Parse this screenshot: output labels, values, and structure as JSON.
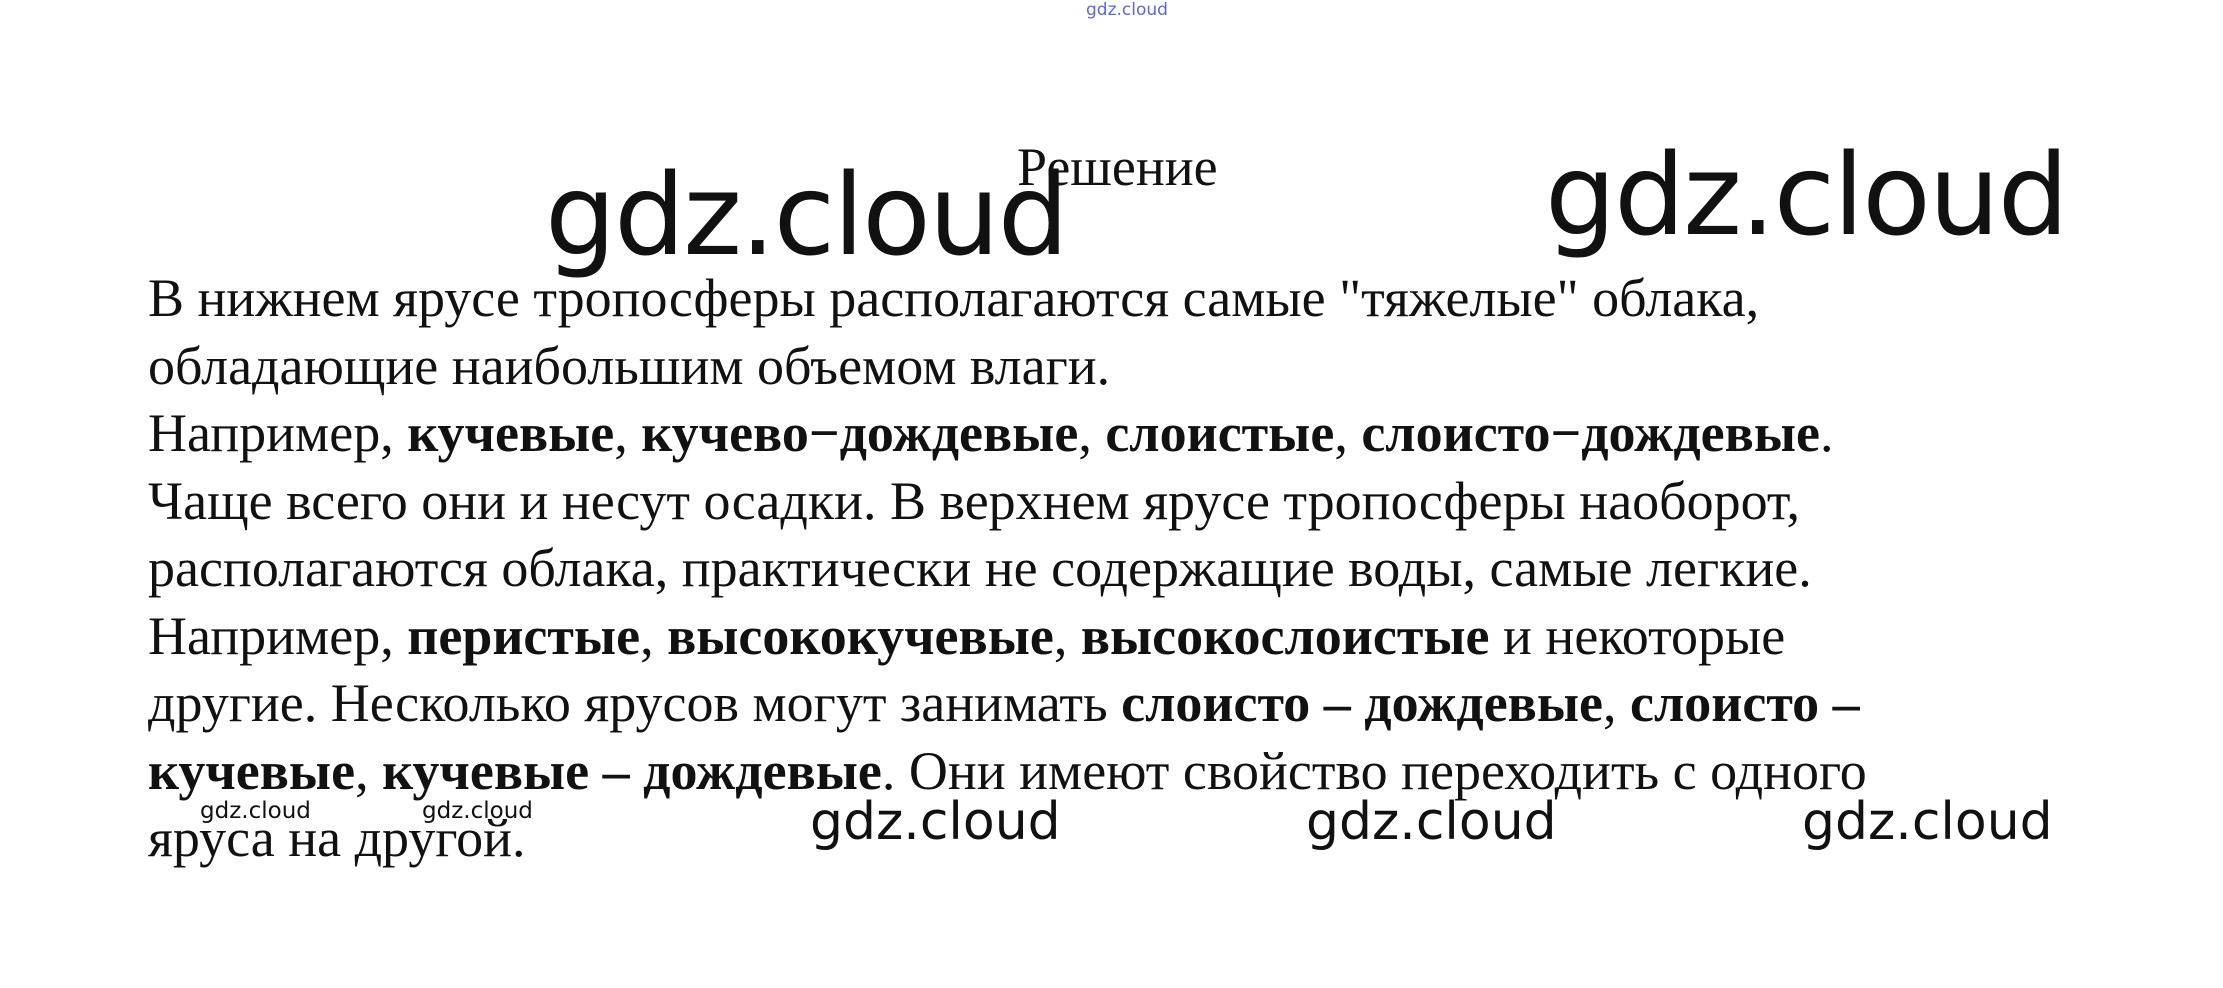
{
  "watermarks": {
    "top": "gdz.cloud",
    "big_left": "gdz.cloud",
    "big_right": "gdz.cloud",
    "small_1": "gdz.cloud",
    "small_2": "gdz.cloud",
    "medium_1": "gdz.cloud",
    "medium_2": "gdz.cloud",
    "medium_3": "gdz.cloud"
  },
  "document": {
    "heading": "Решение",
    "lines": [
      [
        {
          "text": "В нижнем ярусе тропосферы располагаются самые \"тяжелые\" облака,",
          "bold": false
        }
      ],
      [
        {
          "text": "обладающие наибольшим объемом влаги.",
          "bold": false
        }
      ],
      [
        {
          "text": "Например, ",
          "bold": false
        },
        {
          "text": "кучевые",
          "bold": true
        },
        {
          "text": ", ",
          "bold": false
        },
        {
          "text": "кучево−дождевые",
          "bold": true
        },
        {
          "text": ", ",
          "bold": false
        },
        {
          "text": "слоистые",
          "bold": true
        },
        {
          "text": ", ",
          "bold": false
        },
        {
          "text": "слоисто−дождевые",
          "bold": true
        },
        {
          "text": ".",
          "bold": false
        }
      ],
      [
        {
          "text": "Чаще всего они и несут осадки. В верхнем ярусе тропосферы наоборот,",
          "bold": false
        }
      ],
      [
        {
          "text": "располагаются облака, практически не содержащие воды, самые легкие.",
          "bold": false
        }
      ],
      [
        {
          "text": "Например, ",
          "bold": false
        },
        {
          "text": "перистые",
          "bold": true
        },
        {
          "text": ", ",
          "bold": false
        },
        {
          "text": "высококучевые",
          "bold": true
        },
        {
          "text": ", ",
          "bold": false
        },
        {
          "text": "высокослоистые",
          "bold": true
        },
        {
          "text": " и некоторые",
          "bold": false
        }
      ],
      [
        {
          "text": "другие. Несколько ярусов могут занимать ",
          "bold": false
        },
        {
          "text": "слоисто – дождевые",
          "bold": true
        },
        {
          "text": ", ",
          "bold": false
        },
        {
          "text": "слоисто –",
          "bold": true
        }
      ],
      [
        {
          "text": "кучевые",
          "bold": true
        },
        {
          "text": ", ",
          "bold": false
        },
        {
          "text": "кучевые – дождевые",
          "bold": true
        },
        {
          "text": ". Они имеют свойство переходить с одного",
          "bold": false
        }
      ],
      [
        {
          "text": "яруса на другой.",
          "bold": false
        }
      ]
    ]
  }
}
